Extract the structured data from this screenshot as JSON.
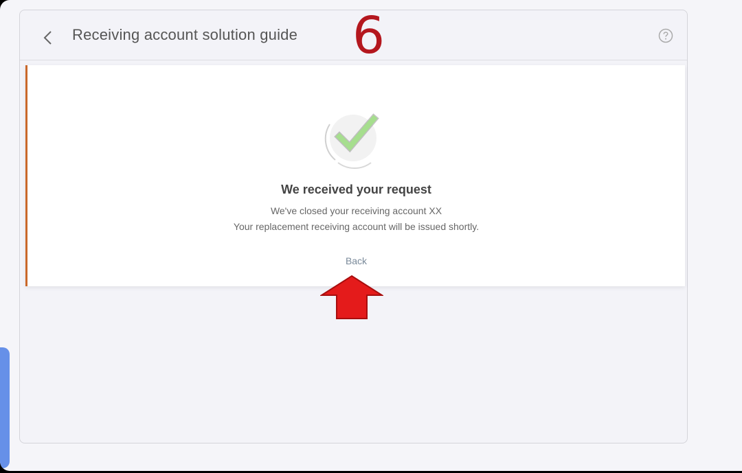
{
  "header": {
    "title": "Receiving account solution guide",
    "step_number": "6"
  },
  "card": {
    "heading": "We received your request",
    "line1": "We've closed your receiving account XX",
    "line2": "Your replacement receiving account will be issued shortly.",
    "back_label": "Back"
  },
  "icons": {
    "back": "chevron-left-icon",
    "help": "question-circle-icon",
    "success": "check-icon",
    "annotation": "arrow-up-icon"
  },
  "colors": {
    "accent_border": "#c9682a",
    "check_green": "#a6de8e",
    "annotation_red": "#e41b1b",
    "step_number": "#b4171e"
  }
}
